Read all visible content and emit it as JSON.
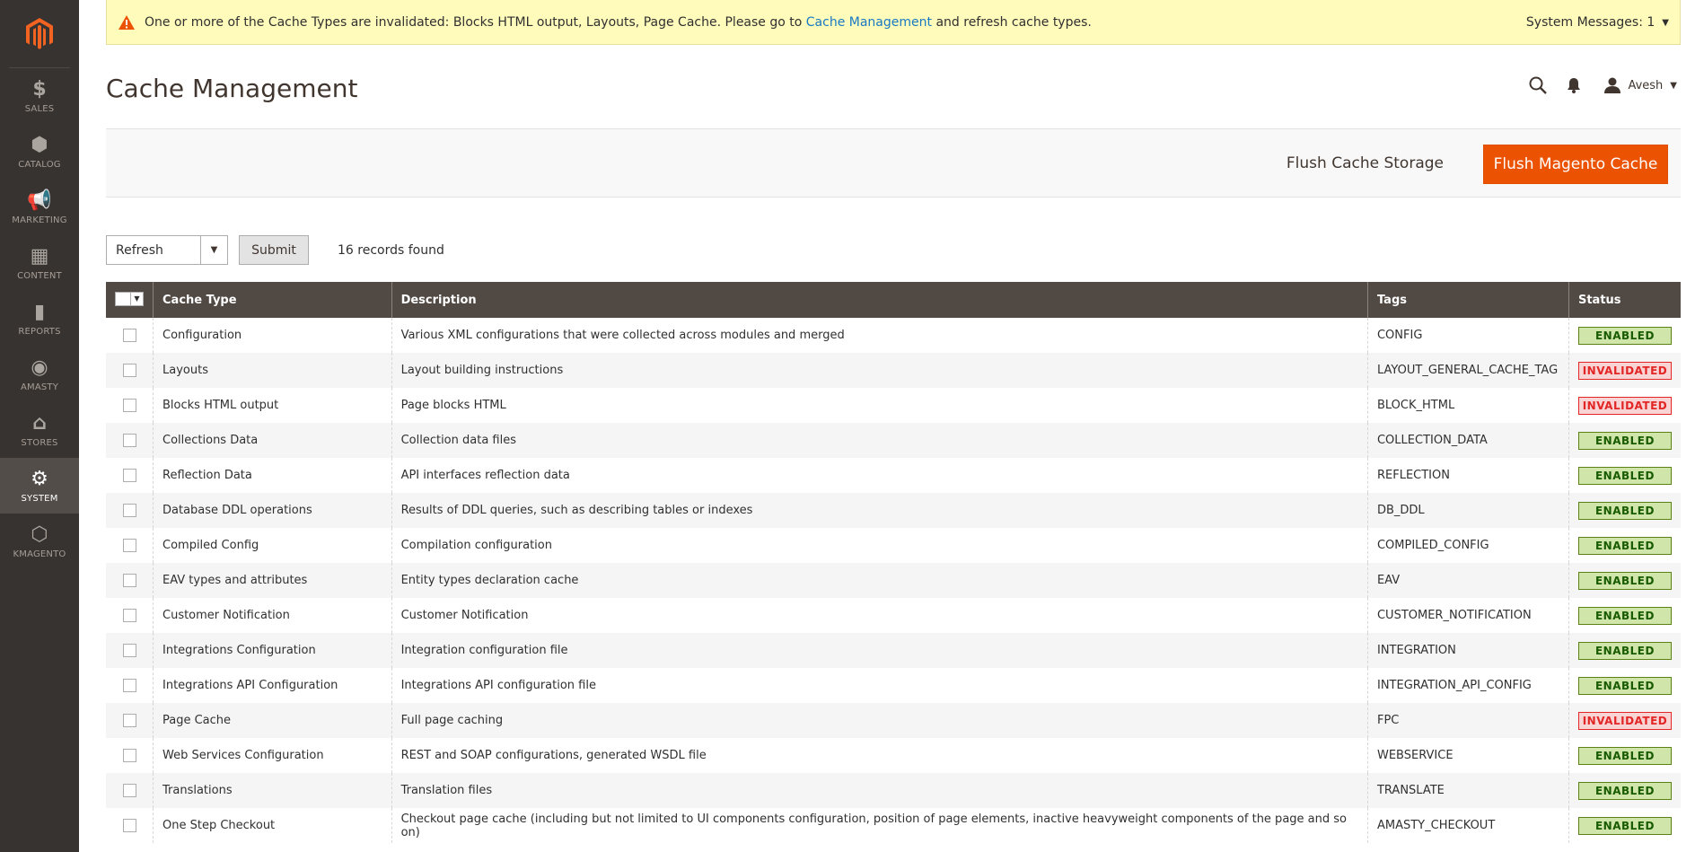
{
  "sidebar": {
    "items": [
      {
        "label": "SALES",
        "icon": "dollar-icon",
        "glyph": "$",
        "active": false
      },
      {
        "label": "CATALOG",
        "icon": "cube-icon",
        "glyph": "⬢",
        "active": false
      },
      {
        "label": "MARKETING",
        "icon": "megaphone-icon",
        "glyph": "📢",
        "active": false
      },
      {
        "label": "CONTENT",
        "icon": "layout-icon",
        "glyph": "▦",
        "active": false
      },
      {
        "label": "REPORTS",
        "icon": "bar-chart-icon",
        "glyph": "▮",
        "active": false
      },
      {
        "label": "AMASTY",
        "icon": "amasty-icon",
        "glyph": "◉",
        "active": false
      },
      {
        "label": "STORES",
        "icon": "store-icon",
        "glyph": "⌂",
        "active": false
      },
      {
        "label": "SYSTEM",
        "icon": "gear-icon",
        "glyph": "⚙",
        "active": true
      },
      {
        "label": "KMAGENTO",
        "icon": "hexagon-icon",
        "glyph": "⬡",
        "active": false
      }
    ]
  },
  "message": {
    "text_before": "One or more of the Cache Types are invalidated: Blocks HTML output, Layouts, Page Cache. Please go to ",
    "link": "Cache Management",
    "text_after": " and refresh cache types.",
    "system_messages": "System Messages: 1"
  },
  "header": {
    "title": "Cache Management",
    "user": "Avesh"
  },
  "actions": {
    "flush_storage": "Flush Cache Storage",
    "flush_magento": "Flush Magento Cache"
  },
  "massaction": {
    "selected": "Refresh",
    "submit": "Submit",
    "records": "16 records found"
  },
  "grid": {
    "columns": [
      "Cache Type",
      "Description",
      "Tags",
      "Status"
    ],
    "rows": [
      {
        "type": "Configuration",
        "desc": "Various XML configurations that were collected across modules and merged",
        "tags": "CONFIG",
        "status": "ENABLED"
      },
      {
        "type": "Layouts",
        "desc": "Layout building instructions",
        "tags": "LAYOUT_GENERAL_CACHE_TAG",
        "status": "INVALIDATED"
      },
      {
        "type": "Blocks HTML output",
        "desc": "Page blocks HTML",
        "tags": "BLOCK_HTML",
        "status": "INVALIDATED"
      },
      {
        "type": "Collections Data",
        "desc": "Collection data files",
        "tags": "COLLECTION_DATA",
        "status": "ENABLED"
      },
      {
        "type": "Reflection Data",
        "desc": "API interfaces reflection data",
        "tags": "REFLECTION",
        "status": "ENABLED"
      },
      {
        "type": "Database DDL operations",
        "desc": "Results of DDL queries, such as describing tables or indexes",
        "tags": "DB_DDL",
        "status": "ENABLED"
      },
      {
        "type": "Compiled Config",
        "desc": "Compilation configuration",
        "tags": "COMPILED_CONFIG",
        "status": "ENABLED"
      },
      {
        "type": "EAV types and attributes",
        "desc": "Entity types declaration cache",
        "tags": "EAV",
        "status": "ENABLED"
      },
      {
        "type": "Customer Notification",
        "desc": "Customer Notification",
        "tags": "CUSTOMER_NOTIFICATION",
        "status": "ENABLED"
      },
      {
        "type": "Integrations Configuration",
        "desc": "Integration configuration file",
        "tags": "INTEGRATION",
        "status": "ENABLED"
      },
      {
        "type": "Integrations API Configuration",
        "desc": "Integrations API configuration file",
        "tags": "INTEGRATION_API_CONFIG",
        "status": "ENABLED"
      },
      {
        "type": "Page Cache",
        "desc": "Full page caching",
        "tags": "FPC",
        "status": "INVALIDATED"
      },
      {
        "type": "Web Services Configuration",
        "desc": "REST and SOAP configurations, generated WSDL file",
        "tags": "WEBSERVICE",
        "status": "ENABLED"
      },
      {
        "type": "Translations",
        "desc": "Translation files",
        "tags": "TRANSLATE",
        "status": "ENABLED"
      },
      {
        "type": "One Step Checkout",
        "desc": "Checkout page cache (including but not limited to UI components configuration, position of page elements, inactive heavyweight components of the page and so on)",
        "tags": "AMASTY_CHECKOUT",
        "status": "ENABLED"
      }
    ]
  },
  "colors": {
    "brand": "#eb5202",
    "sidebar": "#373330",
    "grid_header": "#514943",
    "enabled": "#185b00",
    "invalidated": "#e22626"
  }
}
